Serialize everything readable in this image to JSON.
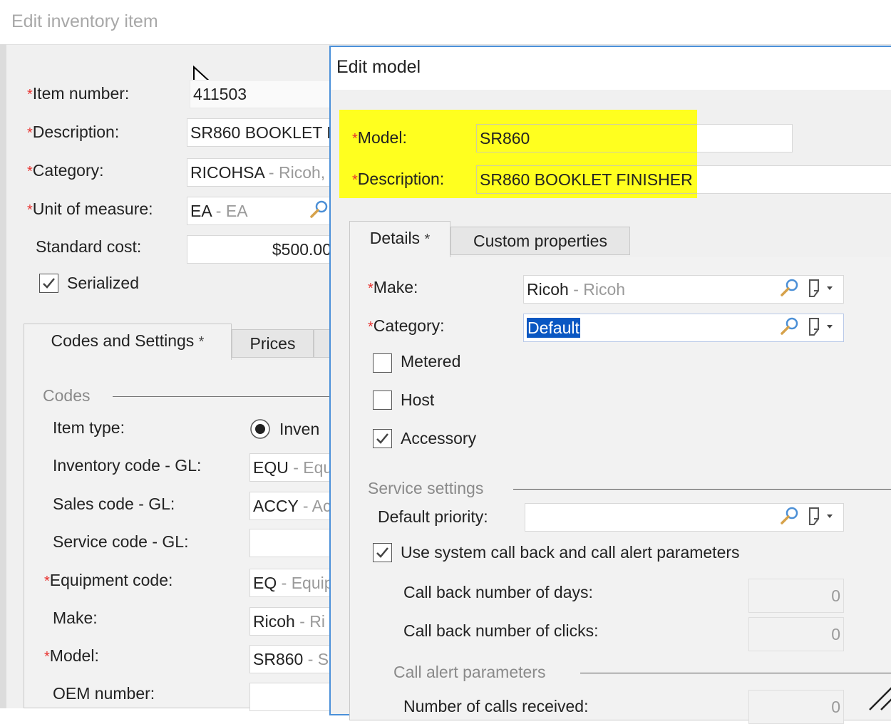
{
  "colors": {
    "required": "#e8322f",
    "highlight": "#ffff1f",
    "selection": "#0a57c2",
    "dialog_border": "#4a90d9"
  },
  "back_window": {
    "title": "Edit inventory item",
    "fields": {
      "item_number": {
        "label": "Item number:",
        "value": "411503"
      },
      "description": {
        "label": "Description:",
        "value": "SR860 BOOKLET F"
      },
      "category": {
        "label": "Category:",
        "code": "RICOHSA",
        "sep": " - ",
        "name": "Ricoh,"
      },
      "unit": {
        "label": "Unit of measure:",
        "code": "EA",
        "sep": " - ",
        "name": "EA",
        "icon": "search-icon"
      },
      "standard_cost": {
        "label": "Standard cost:",
        "value": "$500.00"
      },
      "serialized": {
        "label": "Serialized",
        "checked": true
      }
    },
    "tabs": [
      {
        "label": "Codes and Settings",
        "modified": "*",
        "active": true
      },
      {
        "label": "Prices",
        "active": false
      }
    ],
    "codes_section": "Codes",
    "rows": [
      {
        "label": "Item type:",
        "value": "Inven",
        "kind": "radio"
      },
      {
        "label": "Inventory code - GL:",
        "code": "EQU",
        "sep": " - ",
        "name": "Equ"
      },
      {
        "label": "Sales code - GL:",
        "code": "ACCY",
        "sep": " - ",
        "name": "Ac"
      },
      {
        "label": "Service code - GL:",
        "code": "",
        "sep": "",
        "name": ""
      },
      {
        "label": "Equipment code:",
        "required": true,
        "code": "EQ",
        "sep": " - ",
        "name": "Equip"
      },
      {
        "label": "Make:",
        "code": "Ricoh",
        "sep": " - ",
        "name": "Ri"
      },
      {
        "label": "Model:",
        "required": true,
        "code": "SR860",
        "sep": " - ",
        "name": "S"
      },
      {
        "label": "OEM number:",
        "code": "",
        "sep": "",
        "name": ""
      }
    ]
  },
  "dialog": {
    "title": "Edit model",
    "model": {
      "label": "Model:",
      "value": "SR860"
    },
    "description": {
      "label": "Description:",
      "value": "SR860 BOOKLET FINISHER"
    },
    "tabs": [
      {
        "label": "Details",
        "modified": "*",
        "active": true
      },
      {
        "label": "Custom properties",
        "active": false
      }
    ],
    "make": {
      "label": "Make:",
      "code": "Ricoh",
      "sep": " - ",
      "name": "Ricoh"
    },
    "category": {
      "label": "Category:",
      "value": "Default"
    },
    "checkboxes": [
      {
        "label": "Metered",
        "checked": false
      },
      {
        "label": "Host",
        "checked": false
      },
      {
        "label": "Accessory",
        "checked": true
      }
    ],
    "service_section": "Service settings",
    "default_priority": {
      "label": "Default priority:",
      "value": ""
    },
    "use_system": {
      "label": "Use system call back and call alert parameters",
      "checked": true
    },
    "call_back_days": {
      "label": "Call back number of days:",
      "value": "0"
    },
    "call_back_clicks": {
      "label": "Call back number of clicks:",
      "value": "0"
    },
    "alert_section": "Call alert parameters",
    "calls_received": {
      "label": "Number of calls received:",
      "value": "0"
    }
  }
}
